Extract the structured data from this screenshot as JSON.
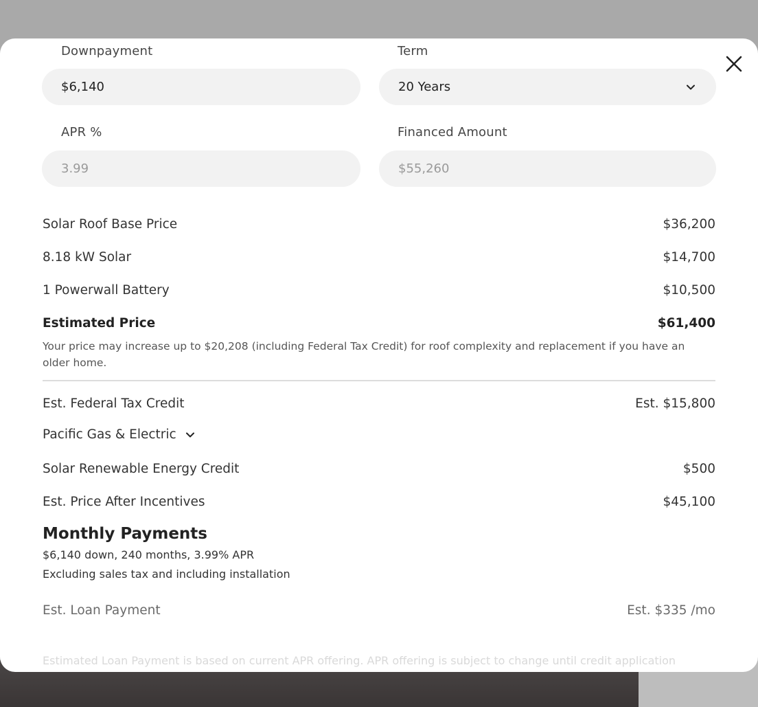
{
  "form": {
    "downpayment_label": "Downpayment",
    "downpayment_value": "$6,140",
    "term_label": "Term",
    "term_value": "20 Years",
    "apr_label": "APR %",
    "apr_value": "3.99",
    "financed_label": "Financed Amount",
    "financed_value": "$55,260"
  },
  "pricing": [
    {
      "label": "Solar Roof Base Price",
      "value": "$36,200"
    },
    {
      "label": "8.18 kW Solar",
      "value": "$14,700"
    },
    {
      "label": "1 Powerwall Battery",
      "value": "$10,500"
    }
  ],
  "estimated": {
    "label": "Estimated Price",
    "value": "$61,400"
  },
  "note": "Your price may increase up to $20,208 (including Federal Tax Credit) for roof complexity and replacement if you have an older home.",
  "incentives": {
    "federal_label": "Est. Federal Tax Credit",
    "federal_value": "Est. $15,800",
    "utility_label": "Pacific Gas & Electric",
    "srec_label": "Solar Renewable Energy Credit",
    "srec_value": "$500",
    "after_label": "Est. Price After Incentives",
    "after_value": "$45,100"
  },
  "monthly": {
    "title": "Monthly Payments",
    "detail": "$6,140 down, 240 months, 3.99% APR",
    "detail2": "Excluding sales tax and including installation",
    "loan_label": "Est. Loan Payment",
    "loan_value": "Est. $335 /mo"
  },
  "footer_text": "Estimated Loan Payment is based on current APR offering. APR offering is subject to change until credit application",
  "icons": {
    "close": "close-icon",
    "chevron": "chevron-down-icon"
  }
}
